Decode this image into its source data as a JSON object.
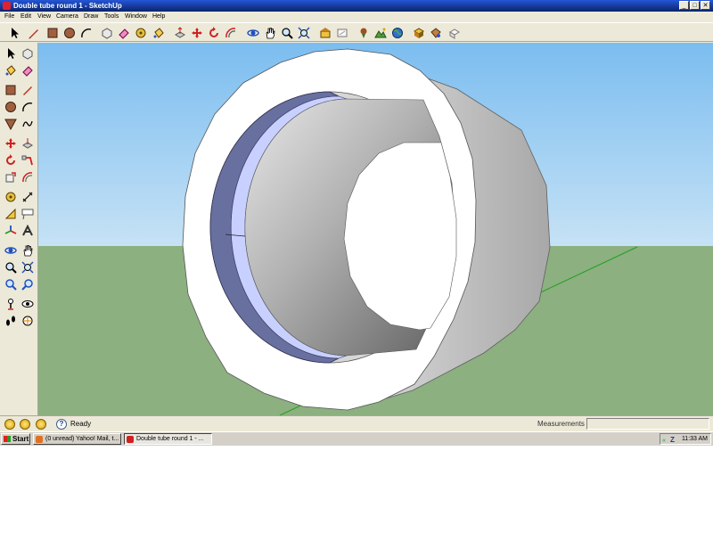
{
  "window": {
    "title": "Double tube round 1 - SketchUp",
    "minimize": "_",
    "maximize": "□",
    "close": "✕"
  },
  "menu": [
    "File",
    "Edit",
    "View",
    "Camera",
    "Draw",
    "Tools",
    "Window",
    "Help"
  ],
  "status": {
    "ready": "Ready",
    "help": "?",
    "measurements_label": "Measurements",
    "measurements_value": ""
  },
  "taskbar": {
    "start": "Start",
    "tasks": [
      {
        "label": "(0 unread) Yahoo! Mail, t..."
      },
      {
        "label": "Double tube round 1 - ..."
      }
    ],
    "tray_icon": "«",
    "tray_z": "Z",
    "clock": "11:33 AM"
  },
  "colors": {
    "sky": "#8ec8f2",
    "ground": "#8cb080",
    "ring_face": "#ffffff",
    "tube_outer": "#c8c8c8",
    "inner_ring": "#6870a0",
    "accent_ring": "#c8d0ff"
  }
}
